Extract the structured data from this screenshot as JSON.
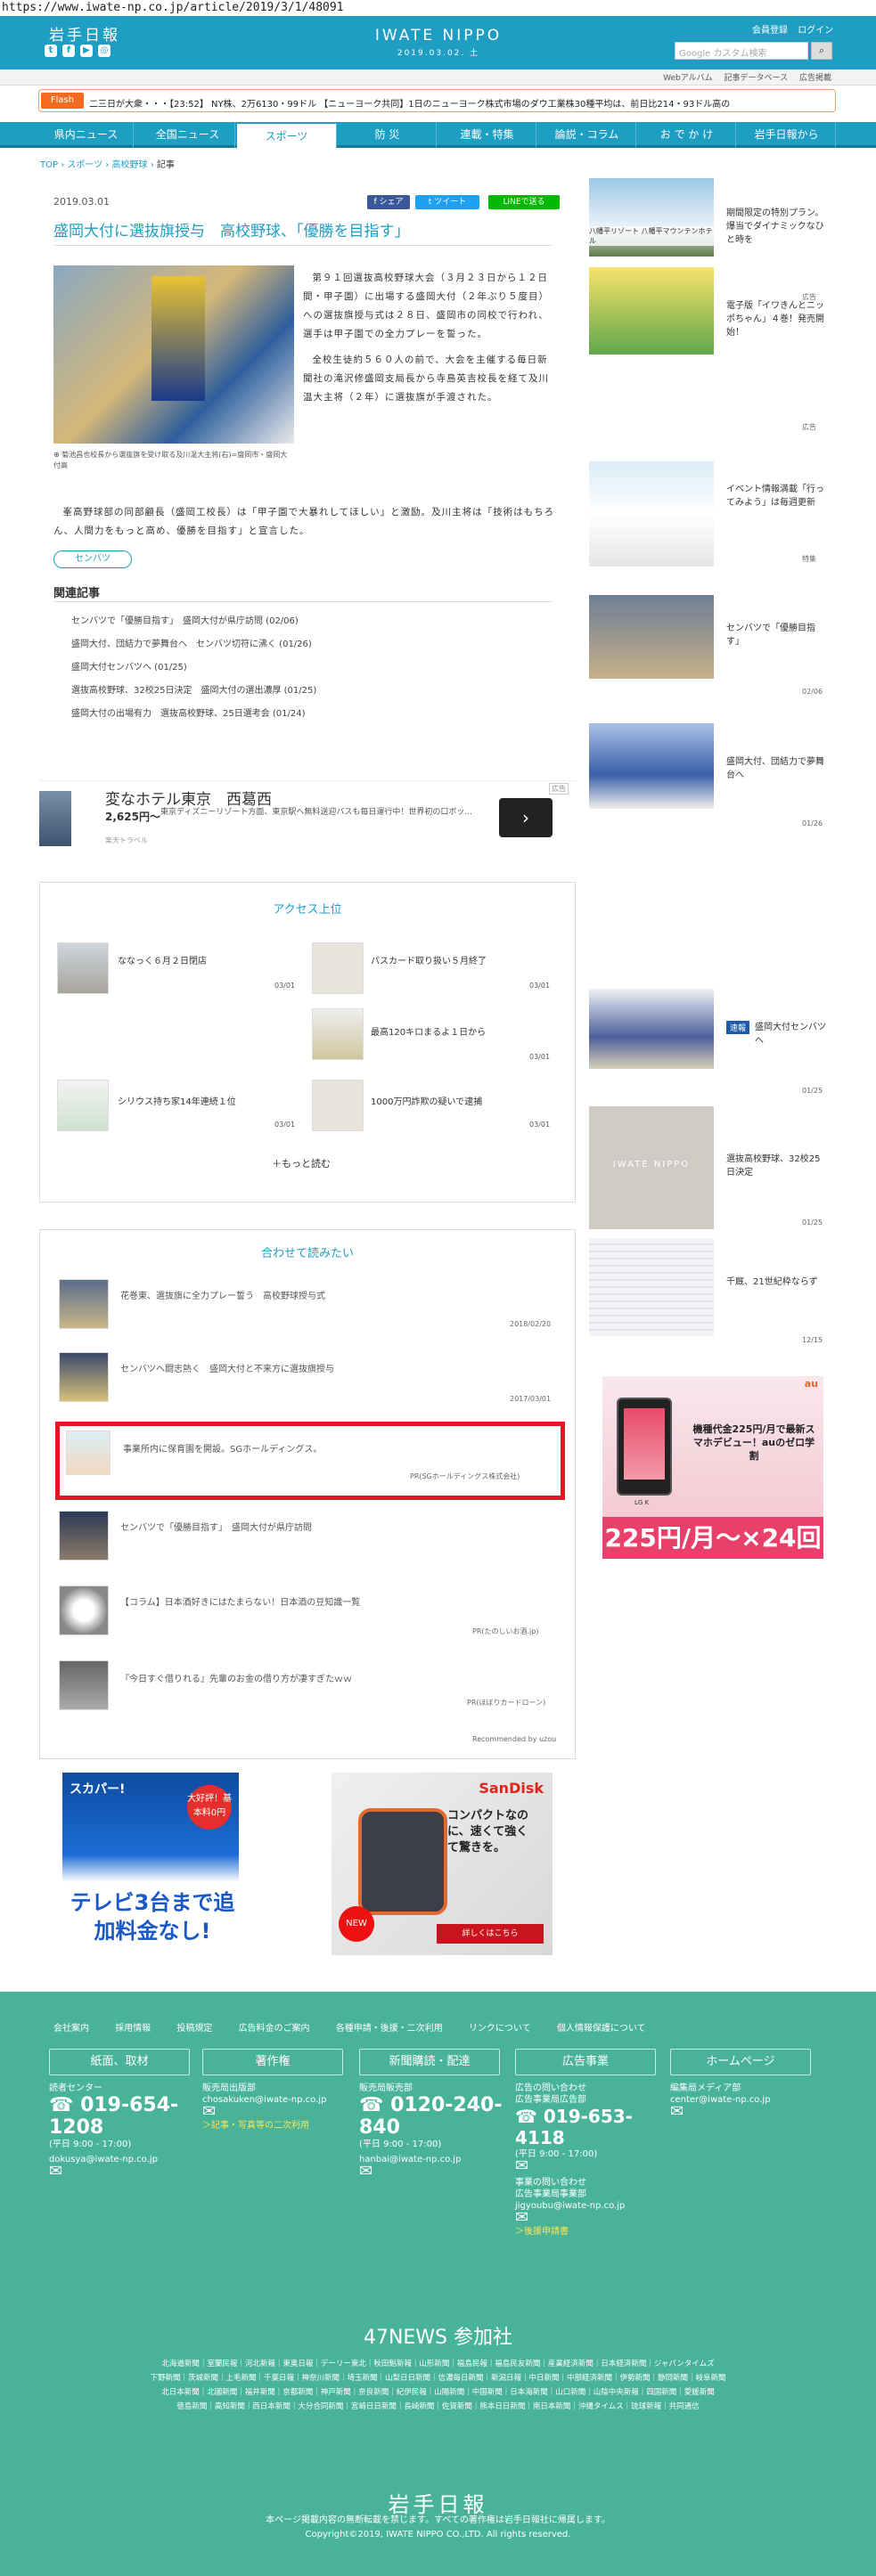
{
  "url": "https://www.iwate-np.co.jp/article/2019/3/1/48091",
  "header": {
    "logo_left": "岩手日報",
    "logo_center": "IWATE NIPPO",
    "header_date": "2019.03.02. 土",
    "member_register": "会員登録",
    "login": "ログイン",
    "search_placeholder": "Google カスタム検索",
    "sub_links": [
      "Webアルバム",
      "記事データベース",
      "広告掲載"
    ]
  },
  "flash": {
    "label": "Flash",
    "text": "二三日が大衆・・・【23:52】 NY株、2万6130・99ドル 【ニューヨーク共同】1日のニューヨーク株式市場のダウ工業株30種平均は、前日比214・93ドル高の"
  },
  "nav": {
    "items": [
      "県内ニュース",
      "全国ニュース",
      "スポーツ",
      "防 災",
      "連載・特集",
      "論説・コラム",
      "お で か け",
      "岩手日報から"
    ],
    "active_index": 2
  },
  "breadcrumb": [
    "TOP",
    "スポーツ",
    "高校野球",
    "記事"
  ],
  "article": {
    "date": "2019.03.01",
    "share_fb": "シェア",
    "share_tw": "ツイート",
    "share_line": "LINEで送る",
    "title": "盛岡大付に選抜旗授与　高校野球、「優勝を目指す」",
    "caption": "菊池昌也校長から選抜旗を受け取る及川温大主将(右)=盛岡市・盛岡大付高",
    "paragraphs": [
      "第９１回選抜高校野球大会（３月２３日から１２日間・甲子園）に出場する盛岡大付（２年ぶり５度目）への選抜旗授与式は２８日、盛岡市の同校で行われ、選手は甲子園での全力プレーを誓った。",
      "全校生徒約５６０人の前で、大会を主催する毎日新聞社の滝沢修盛岡支局長から寺島英吉校長を経て及川温大主将（２年）に選抜旗が手渡された。",
      "峯高野球部の同部顧長（盛岡工校長）は「甲子園で大暴れしてほしい」と激励。及川主将は「技術はもちろん、人間力をもっと高め、優勝を目指す」と宣言した。"
    ],
    "tag": "センバツ",
    "related_heading": "関連記事",
    "related": [
      "センバツで「優勝目指す」　盛岡大付が県庁訪問 (02/06)",
      "盛岡大付、団結力で夢舞台へ　センバツ切符に沸く (01/26)",
      "盛岡大付センバツへ (01/25)",
      "選抜高校野球、32校25日決定　盛岡大付の選出濃厚 (01/25)",
      "盛岡大付の出場有力　選抜高校野球、25日選考会 (01/24)"
    ]
  },
  "ad_hotel": {
    "title": "変なホテル東京　西葛西",
    "price": "2,625円〜",
    "desc": "東京ディズニーリゾート方面、東京駅へ無料送迎バスも毎日運行中！世界初の口ボッ...",
    "source": "楽天トラベル",
    "badge": "広告",
    "arrow": "›"
  },
  "access_ranking": {
    "heading": "アクセス上位",
    "items": [
      {
        "title": "ななっく６月２日閉店",
        "date": "03/01"
      },
      {
        "title": "パスカード取り扱い５月終了",
        "date": "03/01"
      },
      {
        "title": "最高120キロまるよ１日から",
        "date": "03/01"
      },
      {
        "title": "シリウス持ち家14年連続１位",
        "date": "03/01"
      },
      {
        "title": "1000万円詐欺の疑いで逮捕",
        "date": "03/01"
      }
    ],
    "more": "＋もっと読む"
  },
  "recommend": {
    "heading": "合わせて読みたい",
    "items": [
      {
        "title": "花巻東、選抜旗に全力プレー誓う　高校野球授与式",
        "meta": "2018/02/20"
      },
      {
        "title": "センバツへ闘志熱く　盛岡大付と不来方に選抜旗授与",
        "meta": "2017/03/01"
      },
      {
        "title": "事業所内に保育園を開設。SGホールディングス。",
        "meta": "PR(SGホールディングス株式会社)"
      },
      {
        "title": "センバツで「優勝目指す」　盛岡大付が県庁訪問",
        "meta": ""
      },
      {
        "title": "【コラム】日本酒好きにはたまらない！日本酒の豆知識一覧",
        "meta": "PR(たのしいお酒.jp)"
      },
      {
        "title": "『今日すぐ借りれる』先輩のお金の借り方が凄すぎたｗｗ",
        "meta": "PR(ほぼりカードローン)"
      }
    ],
    "powered": "Recommended by uzou"
  },
  "banners": {
    "skapa": {
      "brand": "スカパー!",
      "circle": "大好評！基本料0円",
      "text": "テレビ3台まで追加料金なし!"
    },
    "sandisk": {
      "brand": "SanDisk",
      "text": "コンパクトなのに、速くて強くて驚きを。",
      "new": "NEW",
      "button": "詳しくはこちら"
    }
  },
  "sidebar": {
    "items": [
      {
        "title": "期間限定の特別プラン。爆当でダイナミックなひと時を",
        "meta": "広告",
        "label": "八幡平リゾート 八幡平マウンテンホテル"
      },
      {
        "title": "電子版「イワきんとニッポちゃん」４巻！発売開始！",
        "meta": "広告"
      },
      {
        "title": "イベント情報満載「行ってみよう」は毎週更新",
        "meta": "特集"
      },
      {
        "title": "センバツで「優勝目指す」",
        "meta": "02/06"
      },
      {
        "title": "盛岡大付、団結力で夢舞台へ",
        "meta": "01/26"
      },
      {
        "title": "盛岡大付センバツへ",
        "meta": "01/25",
        "badge": "速報"
      },
      {
        "title": "選抜高校野球、32校25日決定",
        "meta": "01/25"
      },
      {
        "title": "千厩、21世紀枠ならず",
        "meta": "12/15"
      }
    ],
    "au_ad": {
      "brand": "au",
      "text": "機種代金225円/月で最新スマホデビュー！auのゼロ学割",
      "price": "225円/月〜×24回",
      "model": "LG K"
    }
  },
  "footer": {
    "links": [
      "会社案内",
      "採用情報",
      "投稿規定",
      "広告料金のご案内",
      "各種申請・後援・二次利用",
      "リンクについて",
      "個人情報保護について"
    ],
    "columns": [
      {
        "head": "紙面、取材",
        "sub": "読者センター",
        "phone": "019-654-1208",
        "hours": "(平日 9:00 - 17:00)",
        "mail": "dokusya@iwate-np.co.jp"
      },
      {
        "head": "著作権",
        "sub": "販売局出版部",
        "mail": "chosakuken@iwate-np.co.jp",
        "link": "＞記事・写真等の二次利用"
      },
      {
        "head": "新聞購読・配達",
        "sub": "販売局販売部",
        "phone": "0120-240-840",
        "hours": "(平日 9:00 - 17:00)",
        "mail": "hanbai@iwate-np.co.jp"
      },
      {
        "head": "広告事業",
        "sub": "広告の問い合わせ",
        "sub2": "広告事業局広告部",
        "phone": "019-653-4118",
        "hours": "(平日 9:00 - 17:00)",
        "sub3": "事業の問い合わせ",
        "sub4": "広告事業局事業部",
        "mail": "jigyoubu@iwate-np.co.jp",
        "link": "＞後援申請書"
      },
      {
        "head": "ホームページ",
        "sub": "編集局メディア部",
        "mail": "center@iwate-np.co.jp"
      }
    ],
    "n47_title": "47NEWS 参加社",
    "n47_rows": [
      "北海道新聞｜室蘭民報｜河北新報｜東奥日報｜デーリー東北｜秋田魁新報｜山形新聞｜福島民報｜福島民友新聞｜産業経済新聞｜日本経済新聞｜ジャパンタイムズ",
      "下野新聞｜茨城新聞｜上毛新聞｜千葉日報｜神奈川新聞｜埼玉新聞｜山梨日日新聞｜信濃毎日新聞｜新潟日報｜中日新聞｜中部経済新聞｜伊勢新聞｜静岡新聞｜岐阜新聞",
      "北日本新聞｜北國新聞｜福井新聞｜京都新聞｜神戸新聞｜奈良新聞｜紀伊民報｜山陽新聞｜中国新聞｜日本海新聞｜山口新聞｜山陰中央新報｜四国新聞｜愛媛新聞",
      "徳島新聞｜高知新聞｜西日本新聞｜大分合同新聞｜宮崎日日新聞｜長崎新聞｜佐賀新聞｜熊本日日新聞｜南日本新聞｜沖縄タイムス｜琉球新報｜共同通信"
    ],
    "logo": "岩手日報",
    "notice": "本ページ掲載内容の無断転載を禁じます。すべての著作権は岩手日報社に帰属します。",
    "copyright": "Copyright©2019, IWATE NIPPO CO.,LTD. All rights reserved."
  }
}
